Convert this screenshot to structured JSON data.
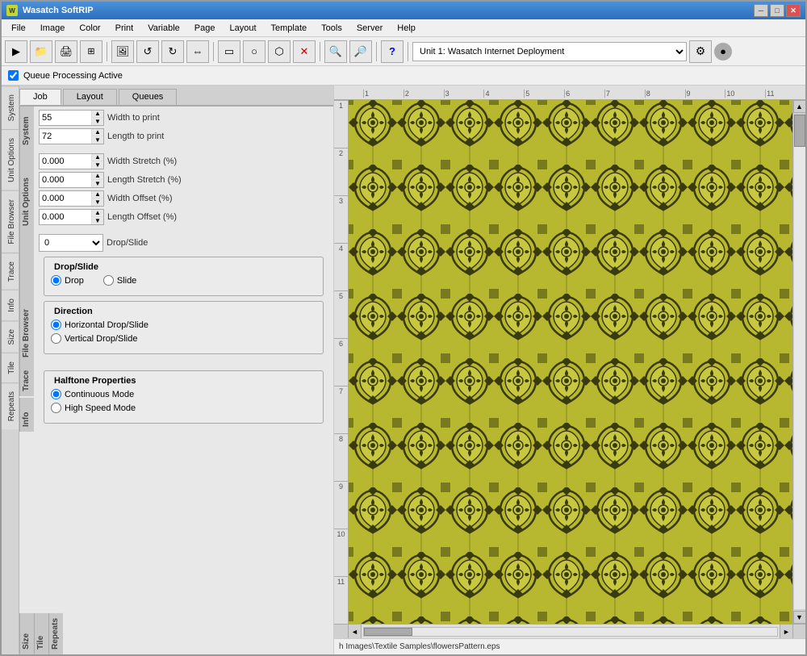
{
  "window": {
    "title": "Wasatch SoftRIP",
    "controls": [
      "minimize",
      "maximize",
      "close"
    ]
  },
  "menubar": {
    "items": [
      "File",
      "Image",
      "Color",
      "Print",
      "Variable",
      "Page",
      "Layout",
      "Template",
      "Tools",
      "Server",
      "Help"
    ]
  },
  "toolbar": {
    "dropdown_value": "Unit 1: Wasatch  Internet Deployment",
    "buttons": [
      "rip",
      "open",
      "save",
      "print",
      "grid",
      "image",
      "rotate-left",
      "rotate-right",
      "flip-h",
      "rect",
      "circle",
      "path",
      "delete",
      "zoom-in",
      "zoom-out",
      "help"
    ]
  },
  "queuebar": {
    "checkbox_label": "Queue Processing Active"
  },
  "tabs": {
    "items": [
      "Job",
      "Layout",
      "Queues"
    ],
    "active": "Job"
  },
  "side_tabs_left": [
    "System",
    "Unit Options",
    "File Browser",
    "Trace",
    "Info"
  ],
  "side_tabs_right": [
    "Repeats",
    "Tile",
    "Size",
    "Info",
    "Trace",
    "File Browser",
    "Unit Options",
    "System"
  ],
  "system_fields": {
    "width_to_print": {
      "label": "Width to print",
      "value": "55"
    },
    "length_to_print": {
      "label": "Length to print",
      "value": "72"
    }
  },
  "unit_options_fields": {
    "width_stretch": {
      "label": "Width Stretch (%)",
      "value": "0.000"
    },
    "length_stretch": {
      "label": "Length Stretch (%)",
      "value": "0.000"
    },
    "width_offset": {
      "label": "Width Offset (%)",
      "value": "0.000"
    },
    "length_offset": {
      "label": "Length Offset (%)",
      "value": "0.000"
    }
  },
  "file_browser_fields": {
    "drop_slide": {
      "label": "Drop/Slide",
      "value": "0"
    }
  },
  "drop_slide_group": {
    "title": "Drop/Slide",
    "options": [
      "Drop",
      "Slide"
    ],
    "selected": "Drop"
  },
  "direction_group": {
    "title": "Direction",
    "options": [
      "Horizontal Drop/Slide",
      "Vertical Drop/Slide"
    ],
    "selected": "Horizontal Drop/Slide"
  },
  "halftone_group": {
    "title": "Halftone Properties",
    "options": [
      "Continuous Mode",
      "High Speed Mode"
    ],
    "selected": "Continuous Mode"
  },
  "ruler": {
    "h_ticks": [
      "1",
      "2",
      "3",
      "4",
      "5",
      "6",
      "7",
      "8",
      "9",
      "10",
      "11"
    ],
    "v_ticks": [
      "1",
      "2",
      "3",
      "4",
      "5",
      "6",
      "7",
      "8",
      "9",
      "10",
      "11"
    ]
  },
  "pathbar": {
    "text": "h Images\\Textile Samples\\flowersPattern.eps"
  },
  "icons": {
    "rip": "▶",
    "open": "📂",
    "save": "💾",
    "print": "🖨",
    "grid": "⊞",
    "minimize": "─",
    "maximize": "□",
    "close": "✕",
    "check": "✓",
    "spin_up": "▲",
    "spin_down": "▼",
    "scroll_up": "▲",
    "scroll_down": "▼",
    "zoom_in": "🔍",
    "zoom_out": "🔎"
  },
  "colors": {
    "accent_blue": "#2c6fbd",
    "bg_main": "#f0f0f0",
    "bg_panel": "#e8e8e8",
    "titlebar_start": "#4a90d9",
    "titlebar_end": "#2c6fbd",
    "pattern_dark": "#5a5a1a",
    "pattern_light": "#c8c840"
  }
}
